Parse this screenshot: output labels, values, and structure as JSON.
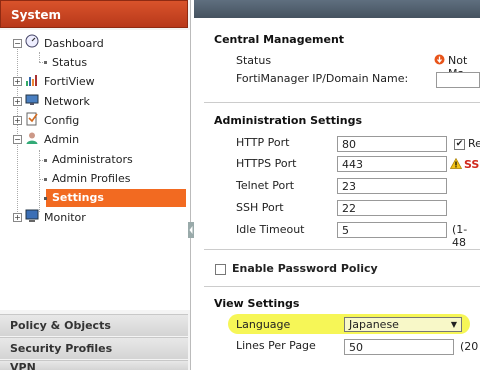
{
  "sidebar": {
    "header": "System",
    "tree": [
      {
        "label": "Dashboard"
      },
      {
        "label": "Status"
      },
      {
        "label": "FortiView"
      },
      {
        "label": "Network"
      },
      {
        "label": "Config"
      },
      {
        "label": "Admin"
      },
      {
        "label": "Administrators"
      },
      {
        "label": "Admin Profiles"
      },
      {
        "label": "Settings"
      },
      {
        "label": "Monitor"
      }
    ],
    "sections": [
      "Policy & Objects",
      "Security Profiles",
      "VPN"
    ]
  },
  "central_management": {
    "title": "Central Management",
    "status_label": "Status",
    "status_value": "Not Ma",
    "fmg_label": "FortiManager IP/Domain Name:",
    "fmg_value": ""
  },
  "admin_settings": {
    "title": "Administration Settings",
    "http_label": "HTTP Port",
    "http_value": "80",
    "http_extra": "Re",
    "https_label": "HTTPS Port",
    "https_value": "443",
    "https_warn": "SSL",
    "telnet_label": "Telnet Port",
    "telnet_value": "23",
    "ssh_label": "SSH Port",
    "ssh_value": "22",
    "idle_label": "Idle Timeout",
    "idle_value": "5",
    "idle_range": "(1-48"
  },
  "password_policy": {
    "label": "Enable Password Policy"
  },
  "view_settings": {
    "title": "View Settings",
    "language_label": "Language",
    "language_value": "Japanese",
    "lines_label": "Lines Per Page",
    "lines_value": "50",
    "lines_range": "(20"
  },
  "colors": {
    "system_header": "#c2401f",
    "selected_item": "#f26a21",
    "highlight": "#f5f53a"
  }
}
